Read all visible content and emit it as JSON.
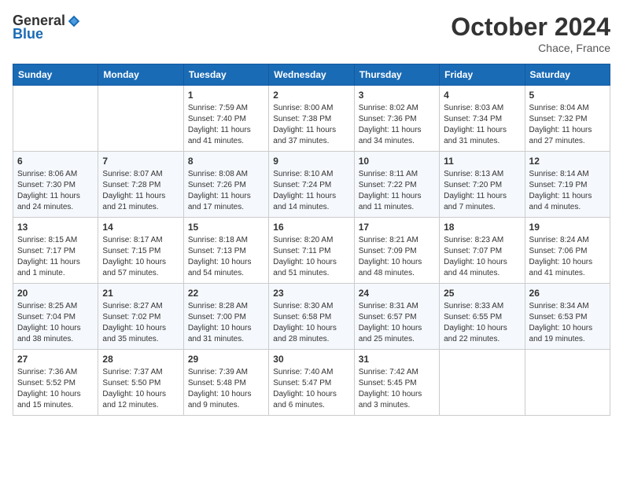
{
  "header": {
    "logo_general": "General",
    "logo_blue": "Blue",
    "month_title": "October 2024",
    "location": "Chace, France"
  },
  "weekdays": [
    "Sunday",
    "Monday",
    "Tuesday",
    "Wednesday",
    "Thursday",
    "Friday",
    "Saturday"
  ],
  "weeks": [
    [
      {
        "day": "",
        "sunrise": "",
        "sunset": "",
        "daylight": ""
      },
      {
        "day": "",
        "sunrise": "",
        "sunset": "",
        "daylight": ""
      },
      {
        "day": "1",
        "sunrise": "Sunrise: 7:59 AM",
        "sunset": "Sunset: 7:40 PM",
        "daylight": "Daylight: 11 hours and 41 minutes."
      },
      {
        "day": "2",
        "sunrise": "Sunrise: 8:00 AM",
        "sunset": "Sunset: 7:38 PM",
        "daylight": "Daylight: 11 hours and 37 minutes."
      },
      {
        "day": "3",
        "sunrise": "Sunrise: 8:02 AM",
        "sunset": "Sunset: 7:36 PM",
        "daylight": "Daylight: 11 hours and 34 minutes."
      },
      {
        "day": "4",
        "sunrise": "Sunrise: 8:03 AM",
        "sunset": "Sunset: 7:34 PM",
        "daylight": "Daylight: 11 hours and 31 minutes."
      },
      {
        "day": "5",
        "sunrise": "Sunrise: 8:04 AM",
        "sunset": "Sunset: 7:32 PM",
        "daylight": "Daylight: 11 hours and 27 minutes."
      }
    ],
    [
      {
        "day": "6",
        "sunrise": "Sunrise: 8:06 AM",
        "sunset": "Sunset: 7:30 PM",
        "daylight": "Daylight: 11 hours and 24 minutes."
      },
      {
        "day": "7",
        "sunrise": "Sunrise: 8:07 AM",
        "sunset": "Sunset: 7:28 PM",
        "daylight": "Daylight: 11 hours and 21 minutes."
      },
      {
        "day": "8",
        "sunrise": "Sunrise: 8:08 AM",
        "sunset": "Sunset: 7:26 PM",
        "daylight": "Daylight: 11 hours and 17 minutes."
      },
      {
        "day": "9",
        "sunrise": "Sunrise: 8:10 AM",
        "sunset": "Sunset: 7:24 PM",
        "daylight": "Daylight: 11 hours and 14 minutes."
      },
      {
        "day": "10",
        "sunrise": "Sunrise: 8:11 AM",
        "sunset": "Sunset: 7:22 PM",
        "daylight": "Daylight: 11 hours and 11 minutes."
      },
      {
        "day": "11",
        "sunrise": "Sunrise: 8:13 AM",
        "sunset": "Sunset: 7:20 PM",
        "daylight": "Daylight: 11 hours and 7 minutes."
      },
      {
        "day": "12",
        "sunrise": "Sunrise: 8:14 AM",
        "sunset": "Sunset: 7:19 PM",
        "daylight": "Daylight: 11 hours and 4 minutes."
      }
    ],
    [
      {
        "day": "13",
        "sunrise": "Sunrise: 8:15 AM",
        "sunset": "Sunset: 7:17 PM",
        "daylight": "Daylight: 11 hours and 1 minute."
      },
      {
        "day": "14",
        "sunrise": "Sunrise: 8:17 AM",
        "sunset": "Sunset: 7:15 PM",
        "daylight": "Daylight: 10 hours and 57 minutes."
      },
      {
        "day": "15",
        "sunrise": "Sunrise: 8:18 AM",
        "sunset": "Sunset: 7:13 PM",
        "daylight": "Daylight: 10 hours and 54 minutes."
      },
      {
        "day": "16",
        "sunrise": "Sunrise: 8:20 AM",
        "sunset": "Sunset: 7:11 PM",
        "daylight": "Daylight: 10 hours and 51 minutes."
      },
      {
        "day": "17",
        "sunrise": "Sunrise: 8:21 AM",
        "sunset": "Sunset: 7:09 PM",
        "daylight": "Daylight: 10 hours and 48 minutes."
      },
      {
        "day": "18",
        "sunrise": "Sunrise: 8:23 AM",
        "sunset": "Sunset: 7:07 PM",
        "daylight": "Daylight: 10 hours and 44 minutes."
      },
      {
        "day": "19",
        "sunrise": "Sunrise: 8:24 AM",
        "sunset": "Sunset: 7:06 PM",
        "daylight": "Daylight: 10 hours and 41 minutes."
      }
    ],
    [
      {
        "day": "20",
        "sunrise": "Sunrise: 8:25 AM",
        "sunset": "Sunset: 7:04 PM",
        "daylight": "Daylight: 10 hours and 38 minutes."
      },
      {
        "day": "21",
        "sunrise": "Sunrise: 8:27 AM",
        "sunset": "Sunset: 7:02 PM",
        "daylight": "Daylight: 10 hours and 35 minutes."
      },
      {
        "day": "22",
        "sunrise": "Sunrise: 8:28 AM",
        "sunset": "Sunset: 7:00 PM",
        "daylight": "Daylight: 10 hours and 31 minutes."
      },
      {
        "day": "23",
        "sunrise": "Sunrise: 8:30 AM",
        "sunset": "Sunset: 6:58 PM",
        "daylight": "Daylight: 10 hours and 28 minutes."
      },
      {
        "day": "24",
        "sunrise": "Sunrise: 8:31 AM",
        "sunset": "Sunset: 6:57 PM",
        "daylight": "Daylight: 10 hours and 25 minutes."
      },
      {
        "day": "25",
        "sunrise": "Sunrise: 8:33 AM",
        "sunset": "Sunset: 6:55 PM",
        "daylight": "Daylight: 10 hours and 22 minutes."
      },
      {
        "day": "26",
        "sunrise": "Sunrise: 8:34 AM",
        "sunset": "Sunset: 6:53 PM",
        "daylight": "Daylight: 10 hours and 19 minutes."
      }
    ],
    [
      {
        "day": "27",
        "sunrise": "Sunrise: 7:36 AM",
        "sunset": "Sunset: 5:52 PM",
        "daylight": "Daylight: 10 hours and 15 minutes."
      },
      {
        "day": "28",
        "sunrise": "Sunrise: 7:37 AM",
        "sunset": "Sunset: 5:50 PM",
        "daylight": "Daylight: 10 hours and 12 minutes."
      },
      {
        "day": "29",
        "sunrise": "Sunrise: 7:39 AM",
        "sunset": "Sunset: 5:48 PM",
        "daylight": "Daylight: 10 hours and 9 minutes."
      },
      {
        "day": "30",
        "sunrise": "Sunrise: 7:40 AM",
        "sunset": "Sunset: 5:47 PM",
        "daylight": "Daylight: 10 hours and 6 minutes."
      },
      {
        "day": "31",
        "sunrise": "Sunrise: 7:42 AM",
        "sunset": "Sunset: 5:45 PM",
        "daylight": "Daylight: 10 hours and 3 minutes."
      },
      {
        "day": "",
        "sunrise": "",
        "sunset": "",
        "daylight": ""
      },
      {
        "day": "",
        "sunrise": "",
        "sunset": "",
        "daylight": ""
      }
    ]
  ]
}
